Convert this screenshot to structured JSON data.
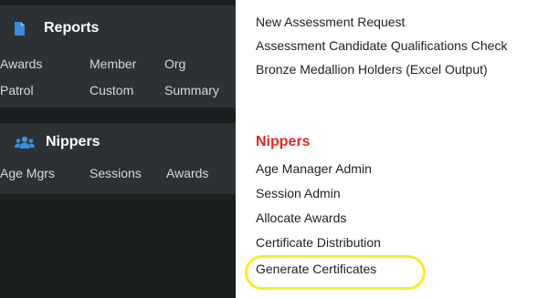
{
  "sidebar": {
    "reports": {
      "icon": "document-icon",
      "title": "Reports",
      "links": [
        "Awards",
        "Member",
        "Org",
        "Patrol",
        "Custom",
        "Summary"
      ]
    },
    "nippers": {
      "icon": "people-group-icon",
      "title": "Nippers",
      "links": [
        "Age Mgrs",
        "Sessions",
        "Awards"
      ]
    }
  },
  "main": {
    "reports_links": [
      "New Assessment Request",
      "Assessment Candidate Qualifications Check",
      "Bronze Medallion Holders (Excel Output)"
    ],
    "nippers_heading": "Nippers",
    "nippers_links": [
      "Age Manager Admin",
      "Session Admin",
      "Allocate Awards",
      "Certificate Distribution",
      "Generate Certificates"
    ]
  },
  "colors": {
    "sidebar_bg": "#1b1f20",
    "section_bg": "#2c3234",
    "icon_blue": "#3b8de0",
    "heading_red": "#e5281e",
    "highlight_yellow": "#f7ec2a"
  }
}
